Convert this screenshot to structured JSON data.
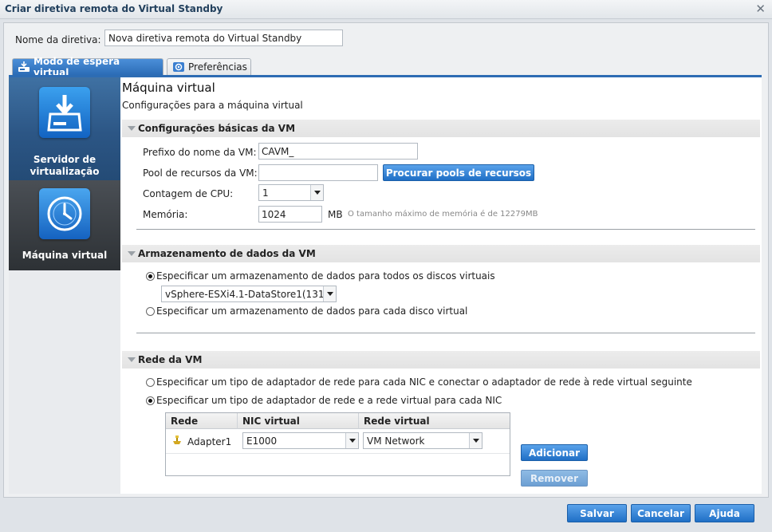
{
  "window": {
    "title": "Criar diretiva remota do Virtual Standby"
  },
  "policy": {
    "name_label": "Nome da diretiva:",
    "name_value": "Nova diretiva remota do Virtual Standby"
  },
  "tabs": [
    {
      "label": "Modo de espera virtual",
      "icon": "standby-tab-icon"
    },
    {
      "label": "Preferências",
      "icon": "preferences-tab-icon"
    }
  ],
  "nav": [
    {
      "label_line1": "Servidor de",
      "label_line2": "virtualização",
      "icon": "server-download-icon"
    },
    {
      "label": "Máquina virtual",
      "icon": "clock-icon"
    }
  ],
  "page": {
    "title": "Máquina virtual",
    "subtitle": "Configurações para a máquina virtual"
  },
  "basic": {
    "header": "Configurações básicas da VM",
    "prefix_label": "Prefixo do nome da VM:",
    "prefix_value": "CAVM_",
    "pool_label": "Pool de recursos da VM:",
    "pool_value": "",
    "browse_label": "Procurar pools de recursos",
    "cpu_label": "Contagem de CPU:",
    "cpu_value": "1",
    "memory_label": "Memória:",
    "memory_value": "1024",
    "memory_unit": "MB",
    "memory_hint": "O tamanho máximo de memória é de 12279MB"
  },
  "storage": {
    "header": "Armazenamento de dados da VM",
    "option_all": "Especificar um armazenamento de dados para todos os discos virtuais",
    "datastore_value": "vSphere-ESXi4.1-DataStore1(131",
    "option_each": "Especificar um armazenamento de dados para cada disco virtual",
    "selected": "all"
  },
  "network": {
    "header": "Rede da VM",
    "option_next": "Especificar um tipo de adaptador de rede para cada NIC e conectar o adaptador de rede à rede virtual seguinte",
    "option_each": "Especificar um tipo de adaptador de rede e a rede virtual para cada NIC",
    "selected": "each",
    "columns": [
      "Rede",
      "NIC virtual",
      "Rede virtual"
    ],
    "rows": [
      {
        "adapter": "Adapter1",
        "nic": "E1000",
        "network": "VM Network"
      }
    ],
    "add_label": "Adicionar",
    "remove_label": "Remover"
  },
  "footer": {
    "save": "Salvar",
    "cancel": "Cancelar",
    "help": "Ajuda"
  },
  "colors": {
    "accent": "#2b6cb6",
    "nav_active": "#2c5685",
    "nav_inactive": "#2d3135"
  }
}
